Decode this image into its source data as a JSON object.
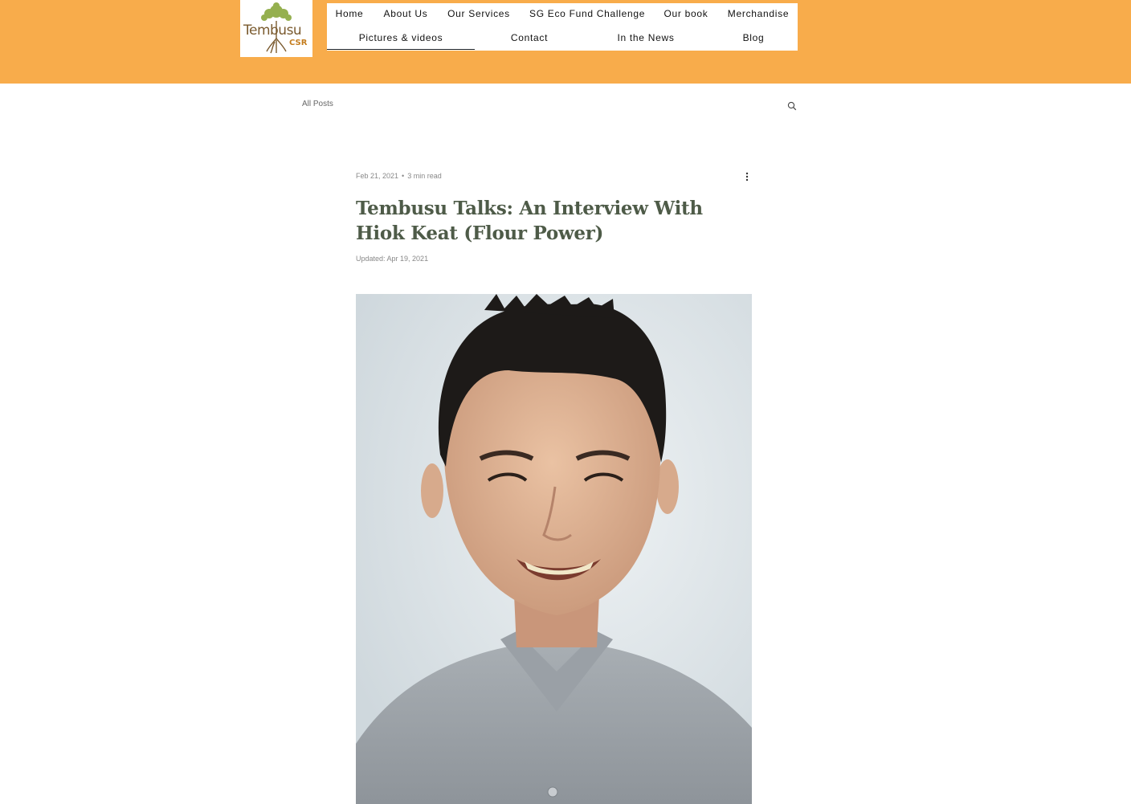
{
  "logo": {
    "wordmark": "Tembusu",
    "sub": "CSR"
  },
  "nav": {
    "row1": [
      "Home",
      "About Us",
      "Our Services",
      "SG Eco Fund Challenge",
      "Our book",
      "Merchandise"
    ],
    "row2": [
      "Pictures & videos",
      "Contact",
      "In the News",
      "Blog"
    ],
    "active": "Pictures & videos"
  },
  "blog": {
    "all_posts": "All Posts"
  },
  "post": {
    "date": "Feb 21, 2021",
    "separator": "•",
    "read_time": "3 min read",
    "title": "Tembusu Talks: An Interview With Hiok Keat (Flour Power)",
    "updated": "Updated: Apr 19, 2021"
  },
  "colors": {
    "header_bg": "#F8AC4B",
    "title": "#4e5b48",
    "logo_brown": "#7a5a2e",
    "logo_accent": "#c47d1f",
    "logo_leaf": "#8aa83c"
  },
  "icons": {
    "search": "search-icon",
    "more": "more-vertical-icon"
  }
}
